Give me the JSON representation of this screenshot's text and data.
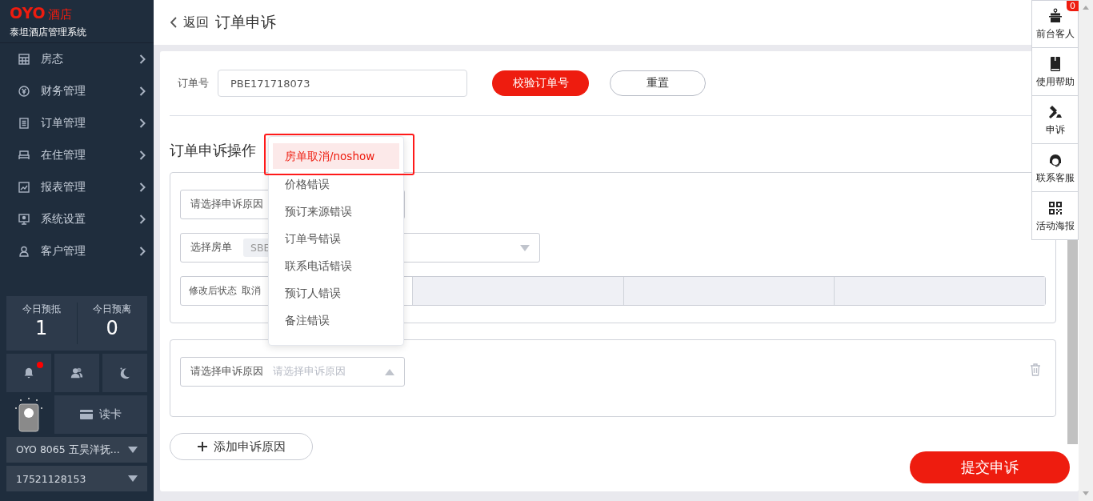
{
  "brand": {
    "logo": "OYO",
    "logo_suffix": "酒店",
    "system_name": "泰坦酒店管理系统"
  },
  "sidebar": {
    "menu": [
      {
        "label": "房态"
      },
      {
        "label": "财务管理"
      },
      {
        "label": "订单管理"
      },
      {
        "label": "在住管理"
      },
      {
        "label": "报表管理"
      },
      {
        "label": "系统设置"
      },
      {
        "label": "客户管理"
      }
    ],
    "stats": [
      {
        "label": "今日预抵",
        "value": "1"
      },
      {
        "label": "今日预离",
        "value": "0"
      }
    ],
    "quick_buttons": [
      {
        "notification": true
      },
      {
        "notification": false
      },
      {
        "notification": false
      }
    ],
    "card_reader": "读卡",
    "selectors": [
      "OYO 8065 五昊洋抚...",
      "17521128153"
    ]
  },
  "header": {
    "back": "返回",
    "title": "订单申诉"
  },
  "order": {
    "label": "订单号",
    "value": "PBE171718073",
    "verify": "校验订单号",
    "reset": "重置"
  },
  "section_title": "订单申诉操作",
  "appeals": [
    {
      "kind": "full",
      "reason_label": "请选择申诉原因",
      "room_label": "选择房单",
      "room_tag": "SBE",
      "status_label": "修改后状态",
      "status_value": "取消",
      "deletable": false
    },
    {
      "kind": "reason",
      "reason_label": "请选择申诉原因",
      "reason_placeholder": "请选择申诉原因",
      "expanded": true,
      "deletable": true
    }
  ],
  "add_button": "添加申诉原因",
  "submit": "提交申诉",
  "dropdown": {
    "annotated": true,
    "options": [
      {
        "label": "房单取消/noshow",
        "selected": true
      },
      {
        "label": "价格错误",
        "selected": false
      },
      {
        "label": "预订来源错误",
        "selected": false
      },
      {
        "label": "订单号错误",
        "selected": false
      },
      {
        "label": "联系电话错误",
        "selected": false
      },
      {
        "label": "预订人错误",
        "selected": false
      },
      {
        "label": "备注错误",
        "selected": false
      }
    ]
  },
  "side_panel": [
    {
      "label": "前台客人",
      "badge": "0"
    },
    {
      "label": "使用帮助"
    },
    {
      "label": "申诉"
    },
    {
      "label": "联系客服"
    },
    {
      "label": "活动海报"
    }
  ]
}
